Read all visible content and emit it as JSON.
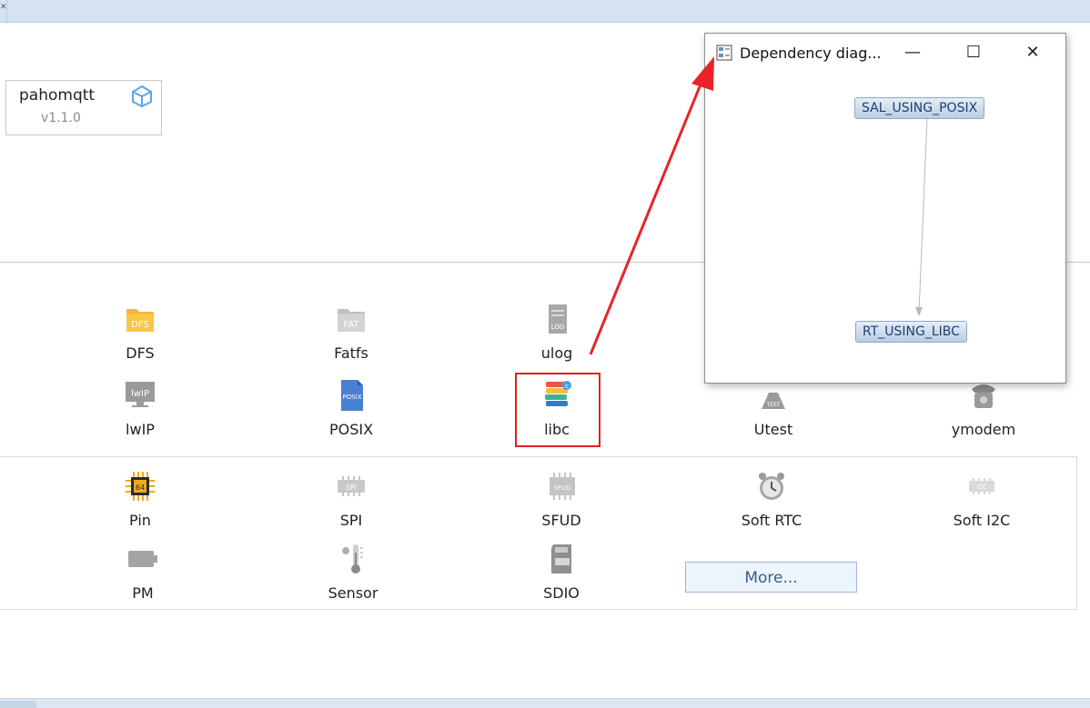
{
  "package": {
    "name": "pahomqtt",
    "version": "v1.1.0"
  },
  "components_row1": [
    {
      "label": "DFS",
      "icon": "dfs-folder-icon",
      "icon_text": "DFS"
    },
    {
      "label": "Fatfs",
      "icon": "fatfs-folder-icon",
      "icon_text": "FAT"
    },
    {
      "label": "ulog",
      "icon": "ulog-file-icon",
      "icon_text": "LOG"
    }
  ],
  "components_row2": [
    {
      "label": "lwIP",
      "icon": "lwip-monitor-icon",
      "icon_text": "lwIP"
    },
    {
      "label": "POSIX",
      "icon": "posix-file-icon",
      "icon_text": "POSIX"
    },
    {
      "label": "libc",
      "icon": "libc-books-icon",
      "icon_text": ""
    },
    {
      "label": "Utest",
      "icon": "utest-flask-icon",
      "icon_text": "TEST"
    },
    {
      "label": "ymodem",
      "icon": "ymodem-phone-icon",
      "icon_text": ""
    }
  ],
  "drivers_row1": [
    {
      "label": "Pin",
      "icon": "pin-chip-icon",
      "icon_text": "64"
    },
    {
      "label": "SPI",
      "icon": "spi-chip-icon",
      "icon_text": "SPI"
    },
    {
      "label": "SFUD",
      "icon": "sfud-chip-icon",
      "icon_text": "SFUD"
    },
    {
      "label": "Soft RTC",
      "icon": "alarm-clock-icon",
      "icon_text": ""
    },
    {
      "label": "Soft I2C",
      "icon": "i2c-chip-icon",
      "icon_text": "I2C"
    }
  ],
  "drivers_row2": [
    {
      "label": "PM",
      "icon": "battery-icon",
      "icon_text": ""
    },
    {
      "label": "Sensor",
      "icon": "thermometer-icon",
      "icon_text": ""
    },
    {
      "label": "SDIO",
      "icon": "sd-card-icon",
      "icon_text": ""
    }
  ],
  "more_button": "More...",
  "dialog": {
    "title": "Dependency diag...",
    "minimize": "—",
    "maximize": "☐",
    "close": "✕",
    "nodes": [
      "SAL_USING_POSIX",
      "RT_USING_LIBC"
    ]
  },
  "colors": {
    "highlight": "#e02020",
    "arrow": "#e8232a",
    "node_text": "#1c3f6e"
  }
}
